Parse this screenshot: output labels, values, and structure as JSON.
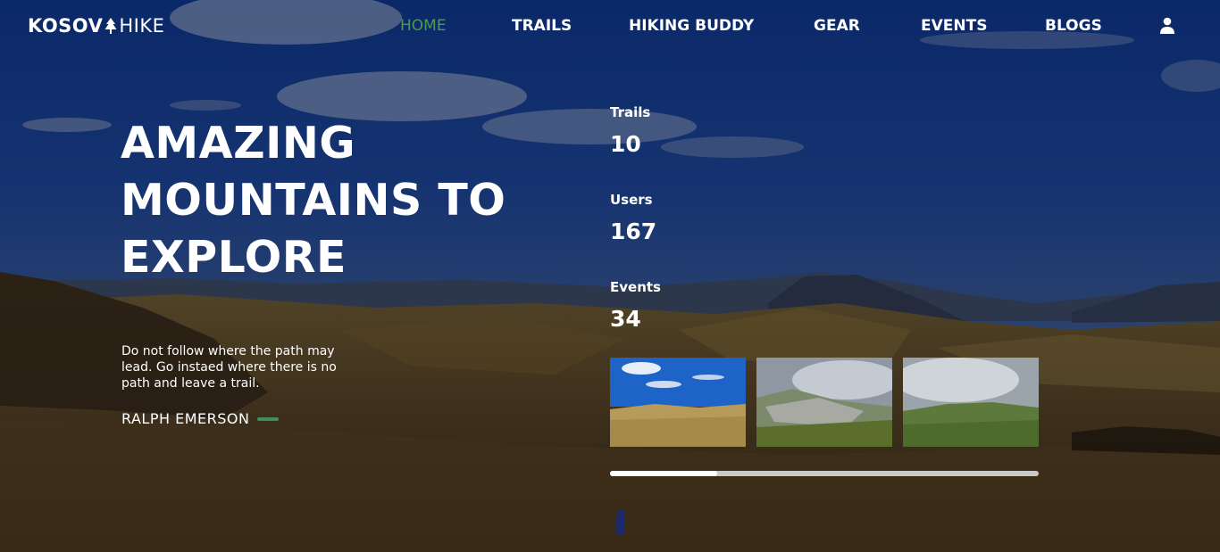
{
  "brand": {
    "name_bold": "KOSOV",
    "name_thin": "HIKE",
    "logo_icon": "pine-tree-icon"
  },
  "nav": {
    "items": [
      {
        "label": "HOME",
        "active": true
      },
      {
        "label": "TRAILS",
        "active": false
      },
      {
        "label": "HIKING BUDDY",
        "active": false
      },
      {
        "label": "GEAR",
        "active": false
      },
      {
        "label": "EVENTS",
        "active": false
      },
      {
        "label": "BLOGS",
        "active": false
      }
    ],
    "user_icon": "user-icon"
  },
  "hero": {
    "title_lines": [
      "AMAZING",
      "MOUNTAINS TO",
      "EXPLORE"
    ],
    "quote": "Do not follow where the path may lead. Go instaed where there is no path and leave a trail.",
    "author": "RALPH EMERSON"
  },
  "stats": [
    {
      "label": "Trails",
      "value": "10"
    },
    {
      "label": "Users",
      "value": "167"
    },
    {
      "label": "Events",
      "value": "34"
    }
  ],
  "gallery": {
    "thumbnails": [
      "blue-sky-valley",
      "misty-rocky-slope",
      "cloudy-green-meadow"
    ],
    "slider_progress": 0.25
  },
  "colors": {
    "accent": "#4e9a5b",
    "author_line": "#3f8f56",
    "sky": "#123a8a",
    "slider_track": "#c9c9c9",
    "slider_fill": "#ffffff"
  }
}
